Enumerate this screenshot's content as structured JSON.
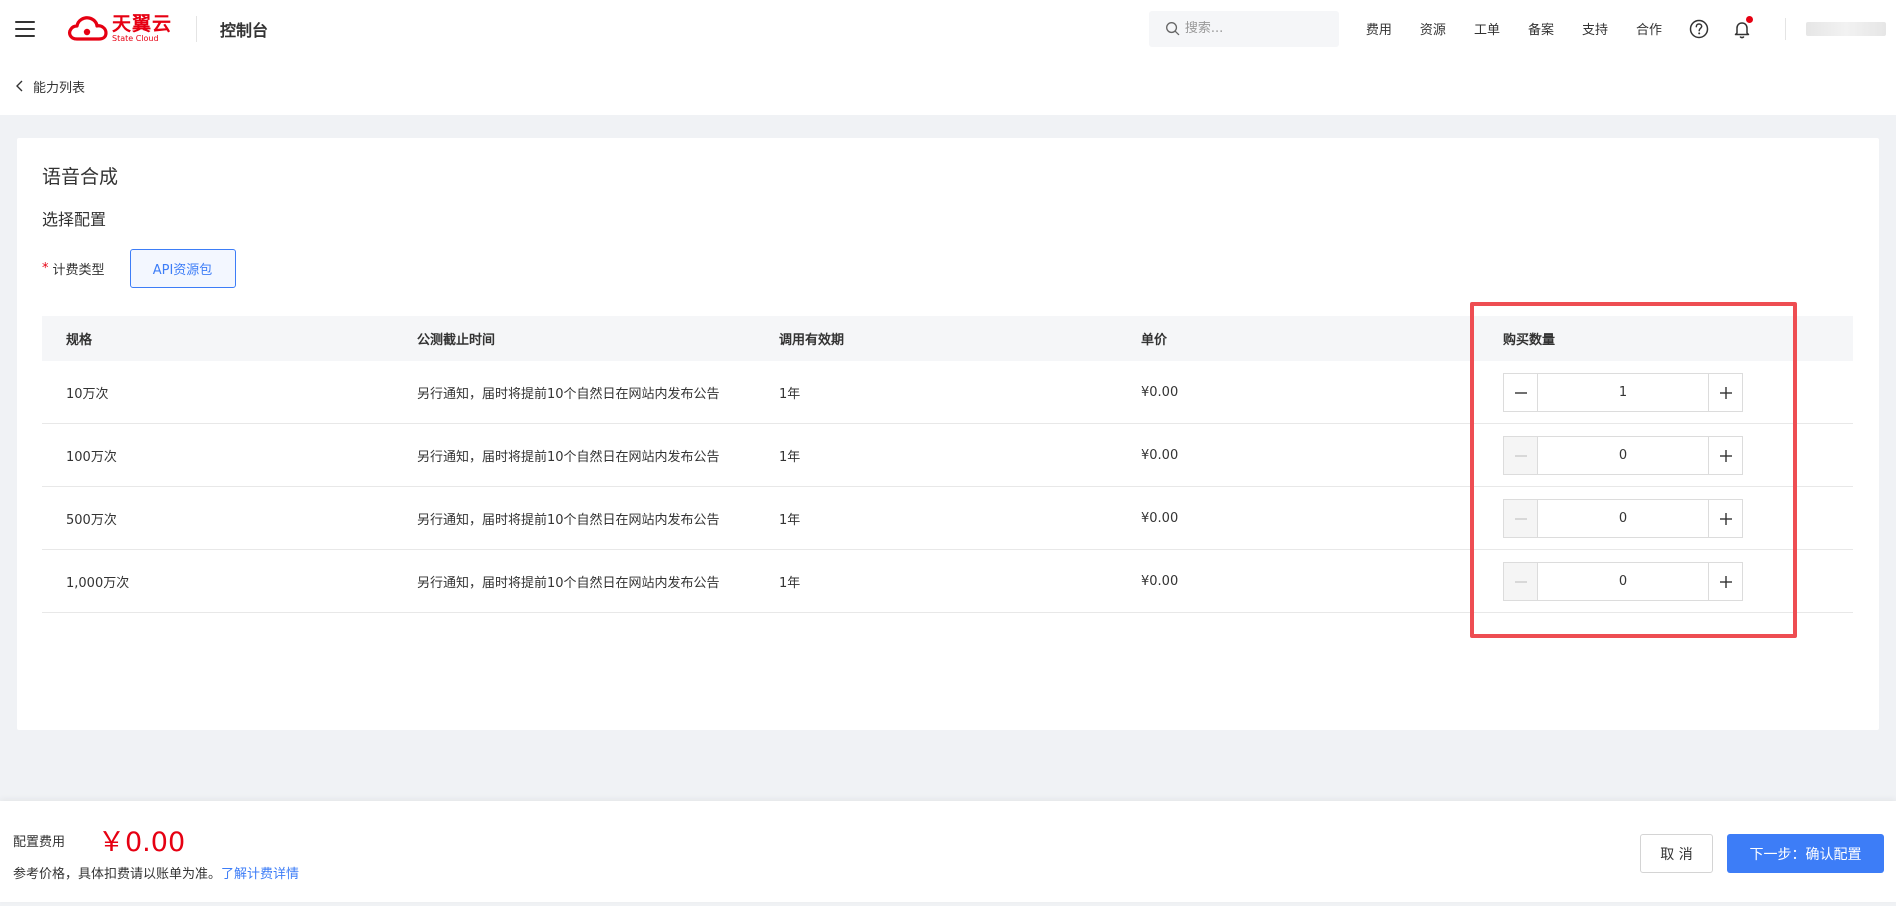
{
  "header": {
    "logo_cn": "天翼云",
    "logo_en": "State Cloud",
    "console_title": "控制台",
    "search_placeholder": "搜索...",
    "nav": [
      "费用",
      "资源",
      "工单",
      "备案",
      "支持",
      "合作"
    ]
  },
  "breadcrumb": {
    "back_label": "能力列表"
  },
  "main": {
    "product_title": "语音合成",
    "section_title": "选择配置",
    "billing_label": "计费类型",
    "billing_option": "API资源包",
    "table": {
      "headers": [
        "规格",
        "公测截止时间",
        "调用有效期",
        "单价",
        "购买数量"
      ],
      "rows": [
        {
          "spec": "10万次",
          "deadline": "另行通知，届时将提前10个自然日在网站内发布公告",
          "validity": "1年",
          "price": "¥0.00",
          "qty": "1"
        },
        {
          "spec": "100万次",
          "deadline": "另行通知，届时将提前10个自然日在网站内发布公告",
          "validity": "1年",
          "price": "¥0.00",
          "qty": "0"
        },
        {
          "spec": "500万次",
          "deadline": "另行通知，届时将提前10个自然日在网站内发布公告",
          "validity": "1年",
          "price": "¥0.00",
          "qty": "0"
        },
        {
          "spec": "1,000万次",
          "deadline": "另行通知，届时将提前10个自然日在网站内发布公告",
          "validity": "1年",
          "price": "¥0.00",
          "qty": "0"
        }
      ]
    }
  },
  "footer": {
    "fee_label": "配置费用",
    "fee_value": "￥0.00",
    "note": "参考价格，具体扣费请以账单为准。",
    "link": "了解计费详情",
    "cancel_label": "取 消",
    "next_label": "下一步：确认配置"
  },
  "colors": {
    "brand_red": "#e60012",
    "primary_blue": "#3d7df7",
    "highlight_red": "#ee4d52"
  }
}
